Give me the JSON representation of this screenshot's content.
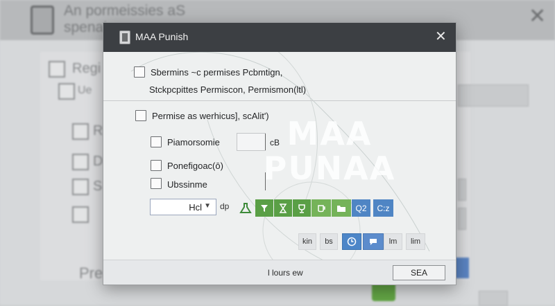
{
  "background": {
    "title_line1": "An pormeissies aS",
    "title_line2": "spenai",
    "items": [
      "Regi",
      "Ue",
      "R",
      "D",
      "S",
      "Pre"
    ],
    "close_glyph": "✕"
  },
  "watermark": {
    "line1": "MAA",
    "line2": "PUNAA"
  },
  "dialog": {
    "title": "MAA Punish",
    "close_glyph": "✕",
    "section1": {
      "line1": "Sbermins ~c permises Pcbmtign,",
      "line2": "Stckpcpittes Permiscon, Permismon(ltl)"
    },
    "section2": {
      "header": "Permise as werhicus], scAlit')",
      "options": [
        {
          "label": "Piamorsomie",
          "suffix": "cB"
        },
        {
          "label": "Ponefigoac(ō)"
        },
        {
          "label": "Ubssinme"
        }
      ]
    },
    "dropdown": {
      "value": "Hcl",
      "unit": "dp"
    },
    "toolbar": {
      "icons": [
        "flask-icon",
        "filter-icon",
        "hourglass-icon",
        "trophy-icon",
        "drink-icon",
        "folder-icon"
      ],
      "labels": [
        "Q2",
        "C:z"
      ]
    },
    "small_buttons": [
      "kin",
      "bs",
      "lm",
      "lim"
    ],
    "footer": {
      "text": "l lours ew",
      "button": "SEA"
    }
  },
  "colors": {
    "green": "#5a9f46",
    "blue": "#4f85c4",
    "titlebar": "#3c3f43"
  }
}
